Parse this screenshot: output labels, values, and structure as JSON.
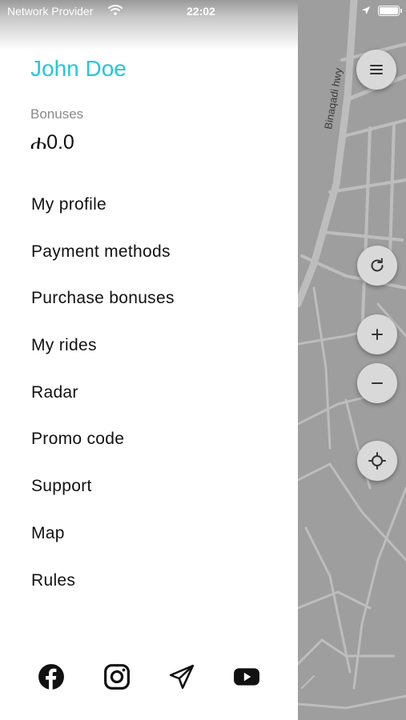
{
  "status_bar": {
    "carrier": "Network Provider",
    "time": "22:02"
  },
  "drawer": {
    "user_name": "John Doe",
    "bonus_label": "Bonuses",
    "bonus_value": "ሐ0.0",
    "menu": [
      {
        "label": "My profile"
      },
      {
        "label": "Payment methods"
      },
      {
        "label": "Purchase bonuses"
      },
      {
        "label": "My rides"
      },
      {
        "label": "Radar"
      },
      {
        "label": "Promo code"
      },
      {
        "label": "Support"
      },
      {
        "label": "Map"
      },
      {
        "label": "Rules"
      }
    ],
    "socials": [
      "facebook-icon",
      "instagram-icon",
      "telegram-icon",
      "youtube-icon"
    ]
  },
  "map": {
    "road_label": "Binaqadi hwy",
    "controls": [
      "menu-icon",
      "refresh-icon",
      "zoom-in-icon",
      "zoom-out-icon",
      "my-location-icon"
    ]
  },
  "colors": {
    "accent": "#26c6da",
    "map_bg": "#9e9e9e",
    "map_road": "#bdbdbd"
  }
}
